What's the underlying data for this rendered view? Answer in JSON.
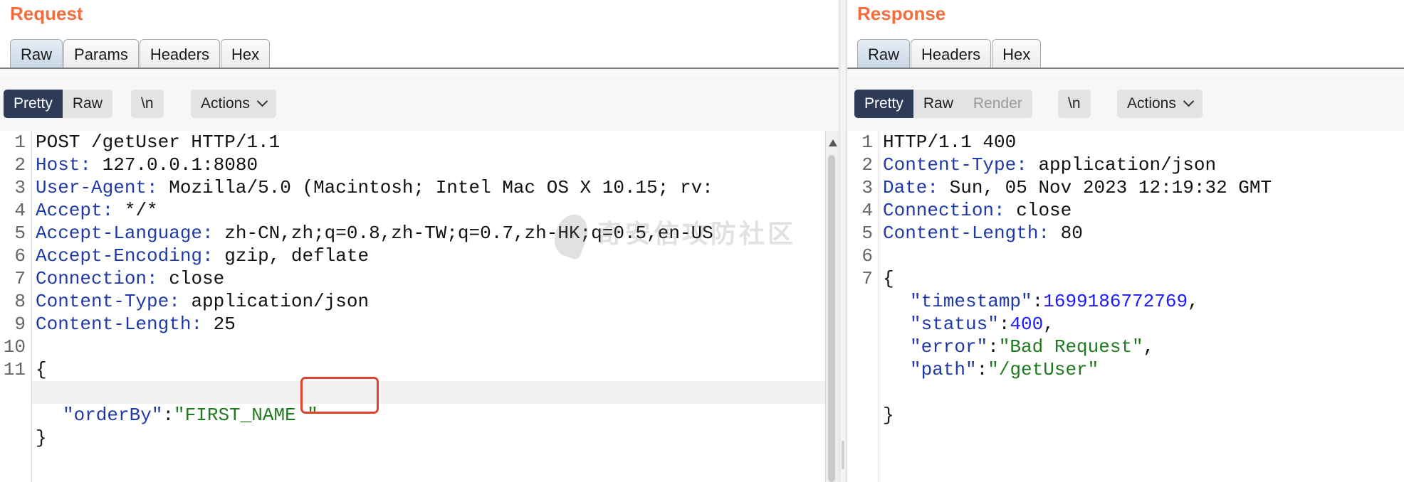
{
  "request": {
    "title": "Request",
    "tabs": [
      "Raw",
      "Params",
      "Headers",
      "Hex"
    ],
    "view_buttons": [
      "Pretty",
      "Raw"
    ],
    "newline_label": "\\n",
    "actions_label": "Actions",
    "lines": [
      {
        "num": "1",
        "key": "",
        "value": "POST /getUser HTTP/1.1"
      },
      {
        "num": "2",
        "key": "Host",
        "value": " 127.0.0.1:8080"
      },
      {
        "num": "3",
        "key": "User-Agent",
        "value": " Mozilla/5.0 (Macintosh; Intel Mac OS X 10.15; rv:"
      },
      {
        "num": "4",
        "key": "Accept",
        "value": " */*"
      },
      {
        "num": "5",
        "key": "Accept-Language",
        "value": " zh-CN,zh;q=0.8,zh-TW;q=0.7,zh-HK;q=0.5,en-US"
      },
      {
        "num": "6",
        "key": "Accept-Encoding",
        "value": " gzip, deflate"
      },
      {
        "num": "7",
        "key": "Connection",
        "value": " close"
      },
      {
        "num": "8",
        "key": "Content-Type",
        "value": " application/json"
      },
      {
        "num": "9",
        "key": "Content-Length",
        "value": " 25"
      },
      {
        "num": "10",
        "key": "",
        "value": ""
      },
      {
        "num": "11",
        "key": "",
        "value": "{"
      }
    ],
    "body_field": {
      "name": "\"orderBy\"",
      "colon": ":",
      "value": "\"FIRST_NAME \""
    },
    "closing_brace": "}"
  },
  "response": {
    "title": "Response",
    "tabs": [
      "Raw",
      "Headers",
      "Hex"
    ],
    "view_buttons": [
      "Pretty",
      "Raw",
      "Render"
    ],
    "newline_label": "\\n",
    "actions_label": "Actions",
    "lines": [
      {
        "num": "1",
        "key": "",
        "value": "HTTP/1.1 400"
      },
      {
        "num": "2",
        "key": "Content-Type",
        "value": " application/json"
      },
      {
        "num": "3",
        "key": "Date",
        "value": " Sun, 05 Nov 2023 12:19:32 GMT"
      },
      {
        "num": "4",
        "key": "Connection",
        "value": " close"
      },
      {
        "num": "5",
        "key": "Content-Length",
        "value": " 80"
      },
      {
        "num": "6",
        "key": "",
        "value": ""
      },
      {
        "num": "7",
        "key": "",
        "value": "{"
      }
    ],
    "json_fields": [
      {
        "name": "\"timestamp\"",
        "value": "1699186772769",
        "type": "number",
        "trail": ","
      },
      {
        "name": "\"status\"",
        "value": "400",
        "type": "number",
        "trail": ","
      },
      {
        "name": "\"error\"",
        "value": "\"Bad Request\"",
        "type": "string",
        "trail": ","
      },
      {
        "name": "\"path\"",
        "value": "\"/getUser\"",
        "type": "string",
        "trail": ""
      }
    ],
    "closing_brace": "}"
  },
  "watermark": "奇安信攻防社区",
  "colors": {
    "accent": "#f26d3d",
    "header_key": "#1e39a8",
    "string": "#1f7a1f",
    "number": "#1a1aff",
    "selected_button": "#2d3b58",
    "highlight_box": "#e0432c"
  }
}
